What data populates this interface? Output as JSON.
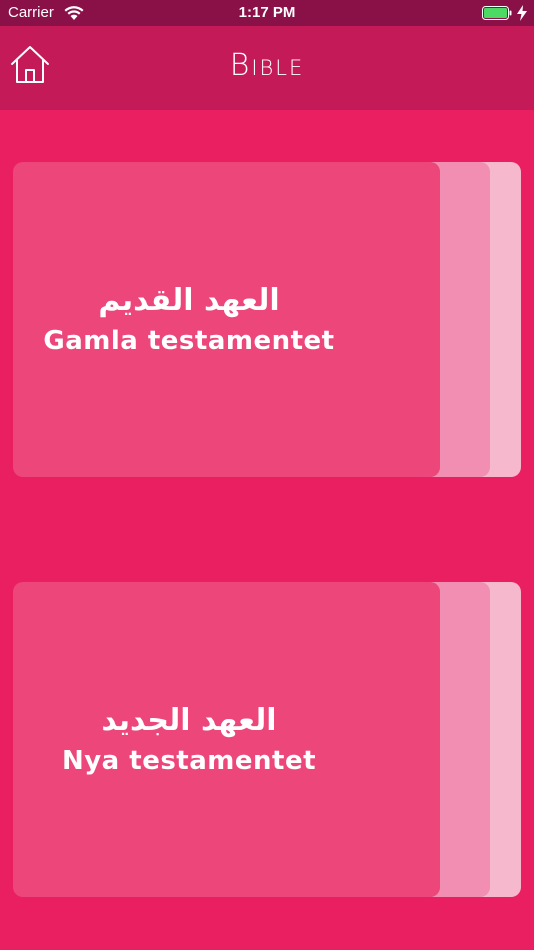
{
  "status_bar": {
    "carrier": "Carrier",
    "time": "1:17 PM",
    "icons": [
      "wifi-icon",
      "battery-icon",
      "charging-icon"
    ],
    "battery_color": "#4cd964"
  },
  "header": {
    "title": "Bible",
    "home_icon": "home-icon",
    "background": "#c41a57"
  },
  "theme": {
    "page_background": "#ea1f62",
    "card_color": "#ec467b"
  },
  "books": [
    {
      "arabic": "العهد القديم",
      "latin": "Gamla testamentet"
    },
    {
      "arabic": "العهد الجديد",
      "latin": "Nya testamentet"
    }
  ]
}
